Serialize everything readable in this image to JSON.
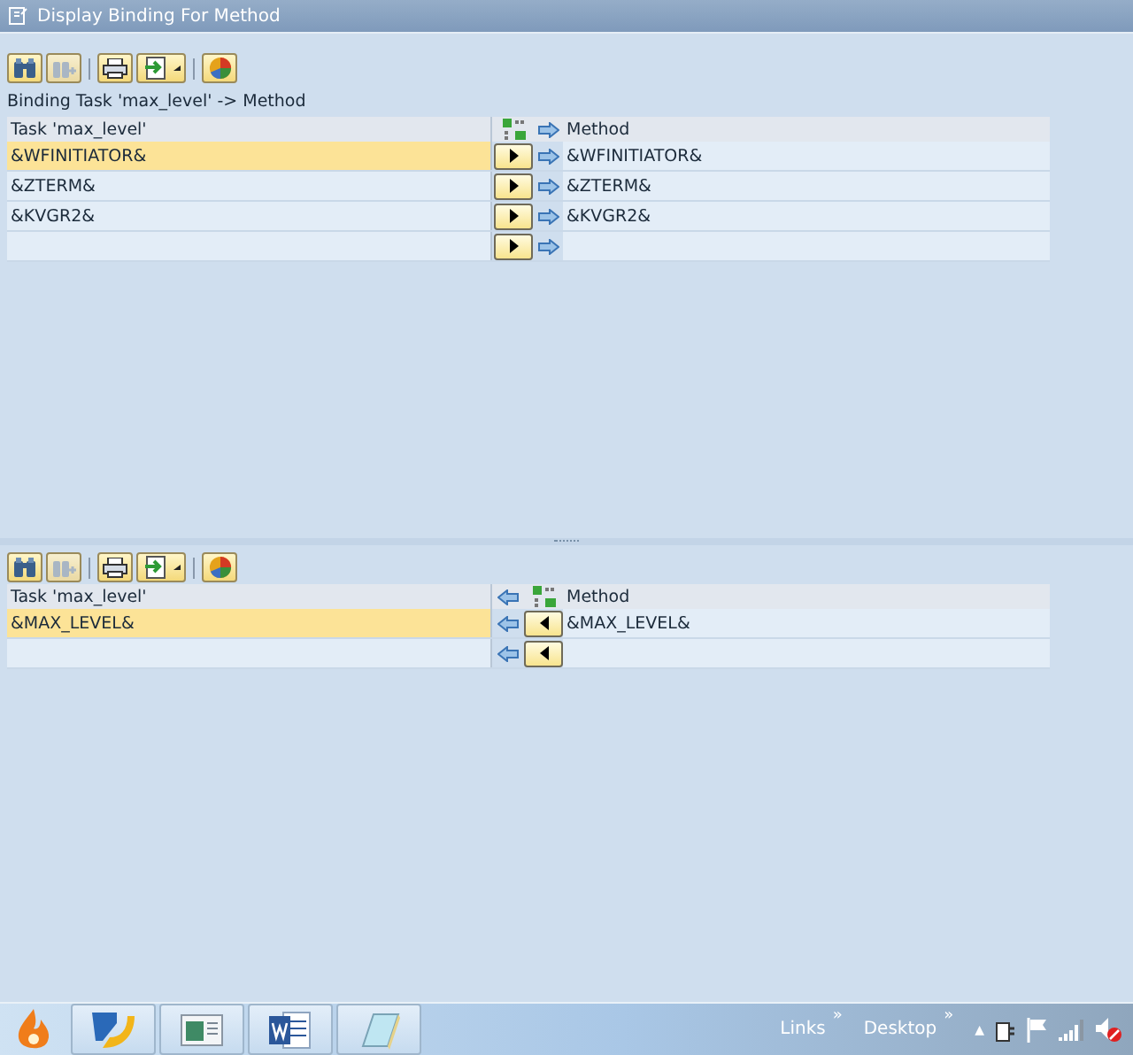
{
  "window": {
    "title": "Display Binding For Method"
  },
  "top_panel": {
    "caption": "Binding Task 'max_level' -> Method",
    "reversed": false,
    "columns": [
      "Task 'max_level'",
      "Method"
    ],
    "rows": [
      {
        "task": "&WFINITIATOR&",
        "method": "&WFINITIATOR&",
        "selected": true
      },
      {
        "task": "&ZTERM&",
        "method": "&ZTERM&",
        "selected": false
      },
      {
        "task": "&KVGR2&",
        "method": "&KVGR2&",
        "selected": false
      },
      {
        "selected": false
      }
    ]
  },
  "bottom_panel": {
    "reversed": true,
    "columns": [
      "Task 'max_level'",
      "Method"
    ],
    "rows": [
      {
        "task": "&MAX_LEVEL&",
        "method": "&MAX_LEVEL&",
        "selected": true
      },
      {
        "selected": false
      }
    ]
  },
  "taskbar": {
    "toolbars": [
      {
        "label": "Links",
        "chevron": "»"
      },
      {
        "label": "Desktop",
        "chevron": "»"
      }
    ],
    "tray_toggle": "▲"
  }
}
